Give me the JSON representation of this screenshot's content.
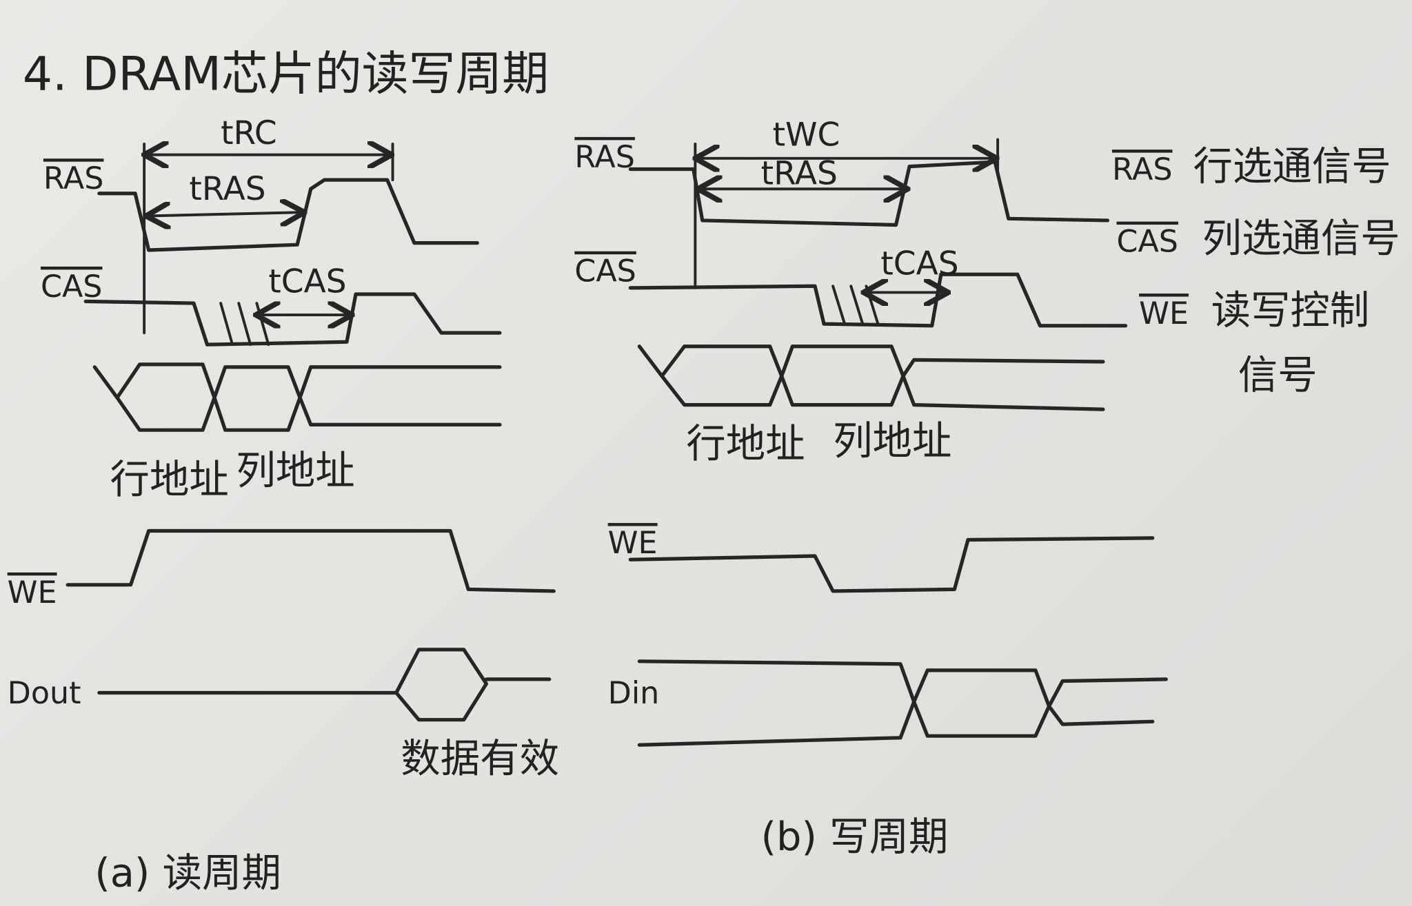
{
  "title": "4. DRAM芯片的读写周期",
  "read_cycle": {
    "caption": "(a) 读周期",
    "signals": {
      "ras": "RAS",
      "cas": "CAS",
      "we": "WE",
      "dout": "Dout"
    },
    "timings": {
      "trc": "tRC",
      "tras": "tRAS",
      "tcas": "tCAS"
    },
    "address_labels": {
      "row": "行地址",
      "col": "列地址"
    },
    "data_valid": "数据有效"
  },
  "write_cycle": {
    "caption": "(b) 写周期",
    "signals": {
      "ras": "RAS",
      "cas": "CAS",
      "we": "WE",
      "din": "Din"
    },
    "timings": {
      "twc": "tWC",
      "tras": "tRAS",
      "tcas": "tCAS"
    },
    "address_labels": {
      "row": "行地址",
      "col": "列地址"
    }
  },
  "legend": [
    {
      "signal": "RAS",
      "desc": "行选通信号"
    },
    {
      "signal": "CAS",
      "desc": "列选通信号"
    },
    {
      "signal": "WE",
      "desc": "读写控制",
      "desc2": "信号"
    }
  ],
  "colors": {
    "ink": "#262626",
    "paper": "#e7e5e2"
  }
}
